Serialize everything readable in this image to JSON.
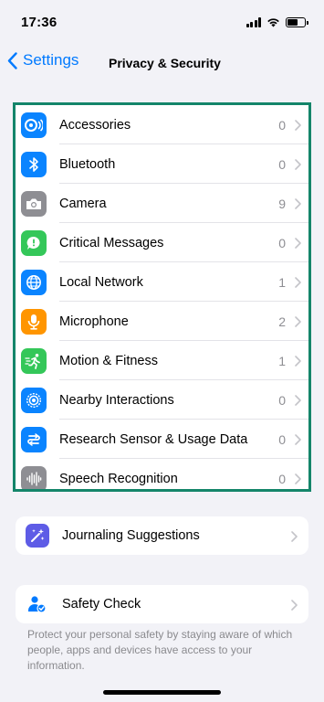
{
  "status_bar": {
    "time": "17:36"
  },
  "nav": {
    "back_label": "Settings",
    "title": "Privacy & Security"
  },
  "colors": {
    "accent": "#007aff",
    "highlight": "#14856a"
  },
  "privacy_items": [
    {
      "label": "Accessories",
      "count": "0",
      "icon": "accessories-icon",
      "color": "#0a84ff"
    },
    {
      "label": "Bluetooth",
      "count": "0",
      "icon": "bluetooth-icon",
      "color": "#0a84ff"
    },
    {
      "label": "Camera",
      "count": "9",
      "icon": "camera-icon",
      "color": "#8e8e93"
    },
    {
      "label": "Critical Messages",
      "count": "0",
      "icon": "critical-messages-icon",
      "color": "#34c759"
    },
    {
      "label": "Local Network",
      "count": "1",
      "icon": "globe-icon",
      "color": "#0a84ff"
    },
    {
      "label": "Microphone",
      "count": "2",
      "icon": "microphone-icon",
      "color": "#ff9500"
    },
    {
      "label": "Motion & Fitness",
      "count": "1",
      "icon": "running-figure-icon",
      "color": "#34c759"
    },
    {
      "label": "Nearby Interactions",
      "count": "0",
      "icon": "nearby-interactions-icon",
      "color": "#0a84ff"
    },
    {
      "label": "Research Sensor & Usage Data",
      "count": "0",
      "icon": "research-icon",
      "color": "#0a84ff"
    },
    {
      "label": "Speech Recognition",
      "count": "0",
      "icon": "waveform-icon",
      "color": "#8e8e93"
    }
  ],
  "journaling": {
    "label": "Journaling Suggestions",
    "icon": "sparkles-icon",
    "color": "#5e5ce6"
  },
  "safety_check": {
    "label": "Safety Check",
    "icon": "person-check-icon",
    "footer": "Protect your personal safety by staying aware of which people, apps and devices have access to your information."
  }
}
